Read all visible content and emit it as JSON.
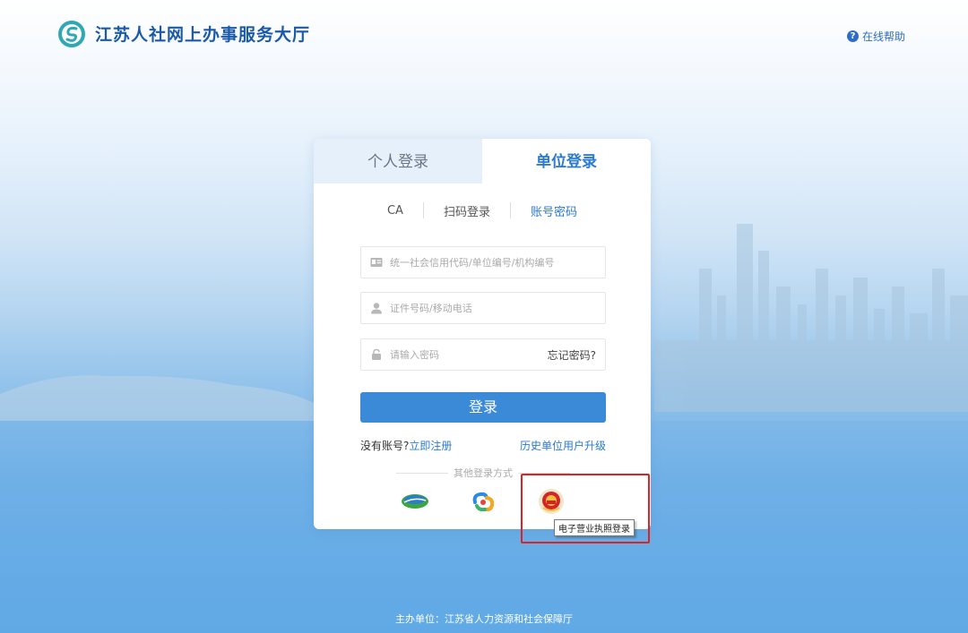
{
  "header": {
    "title": "江苏人社网上办事服务大厅",
    "help_label": "在线帮助"
  },
  "tabs": {
    "personal": "个人登录",
    "unit": "单位登录"
  },
  "subtabs": {
    "ca": "CA",
    "scan": "扫码登录",
    "account": "账号密码"
  },
  "form": {
    "credit_code_placeholder": "统一社会信用代码/单位编号/机构编号",
    "id_phone_placeholder": "证件号码/移动电话",
    "password_placeholder": "请输入密码",
    "forget_label": "忘记密码?",
    "login_label": "登录"
  },
  "register": {
    "no_account": "没有账号?",
    "register_now": "立即注册",
    "upgrade": "历史单位用户升级"
  },
  "other_login": {
    "label": "其他登录方式",
    "tooltip": "电子营业执照登录",
    "icons": [
      "jiangsu-gov-icon",
      "swirl-app-icon",
      "national-emblem-icon"
    ]
  },
  "footer": {
    "text": "主办单位：江苏省人力资源和社会保障厅"
  },
  "colors": {
    "accent": "#2b7ad6",
    "button": "#3b8ad8",
    "highlight_box": "#e02121"
  }
}
